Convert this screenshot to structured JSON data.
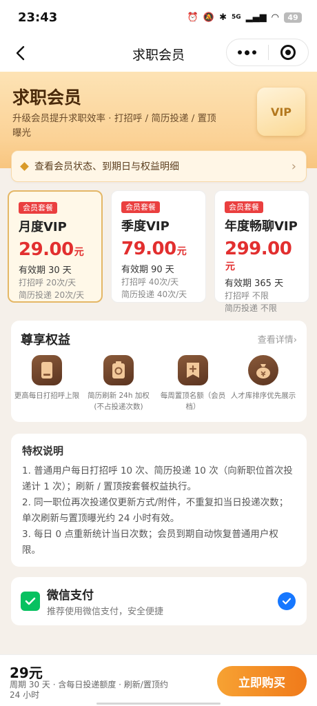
{
  "status_bar": {
    "time": "23:43",
    "network": "5G",
    "battery": "49"
  },
  "nav": {
    "title": "求职会员"
  },
  "hero": {
    "title": "求职会员",
    "subtitle": "升级会员提升求职效率 · 打招呼 / 简历投递 / 置顶曝光",
    "badge": "VIP"
  },
  "status_link": {
    "label": "查看会员状态、到期日与权益明细"
  },
  "plans": [
    {
      "tag": "会员套餐",
      "name": "月度VIP",
      "price": "29.00",
      "unit": "元",
      "validity": "有效期 30 天",
      "greet": "打招呼 20次/天",
      "resume": "简历投递 20次/天",
      "selected": true
    },
    {
      "tag": "会员套餐",
      "name": "季度VIP",
      "price": "79.00",
      "unit": "元",
      "validity": "有效期 90 天",
      "greet": "打招呼 40次/天",
      "resume": "简历投递 40次/天",
      "selected": false
    },
    {
      "tag": "会员套餐",
      "name": "年度畅聊VIP",
      "price": "299.00",
      "unit": "元",
      "validity": "有效期 365 天",
      "greet": "打招呼 不限",
      "resume": "简历投递 不限",
      "selected": false
    }
  ],
  "benefits": {
    "title": "尊享权益",
    "see_more": "查看详情",
    "items": [
      {
        "icon": "phone-icon",
        "label": "更高每日打招呼上限"
      },
      {
        "icon": "refresh-badge-icon",
        "label": "简历刷新 24h 加权(不占投递次数)"
      },
      {
        "icon": "pin-plus-icon",
        "label": "每周置顶名额（会员档）"
      },
      {
        "icon": "money-bag-icon",
        "label": "人才库排序优先展示"
      }
    ]
  },
  "notes": {
    "title": "特权说明",
    "items": [
      "1. 普通用户每日打招呼 10 次、简历投递 10 次（向新职位首次投递计 1 次）；刷新 / 置顶按套餐权益执行。",
      "2. 同一职位再次投递仅更新方式/附件，不重复扣当日投递次数；单次刷新与置顶曝光约 24 小时有效。",
      "3. 每日 0 点重新统计当日次数；会员到期自动恢复普通用户权限。"
    ]
  },
  "payment": {
    "name": "微信支付",
    "desc": "推荐使用微信支付，安全便捷",
    "selected": true
  },
  "bottom": {
    "total": "29元",
    "note": "周期 30 天 · 含每日投递额度 · 刷新/置顶约 24 小时",
    "buy": "立即购买"
  },
  "colors": {
    "accent": "#f08a24",
    "price": "#e22f2f",
    "wechat": "#07c160",
    "check": "#1677ff"
  }
}
